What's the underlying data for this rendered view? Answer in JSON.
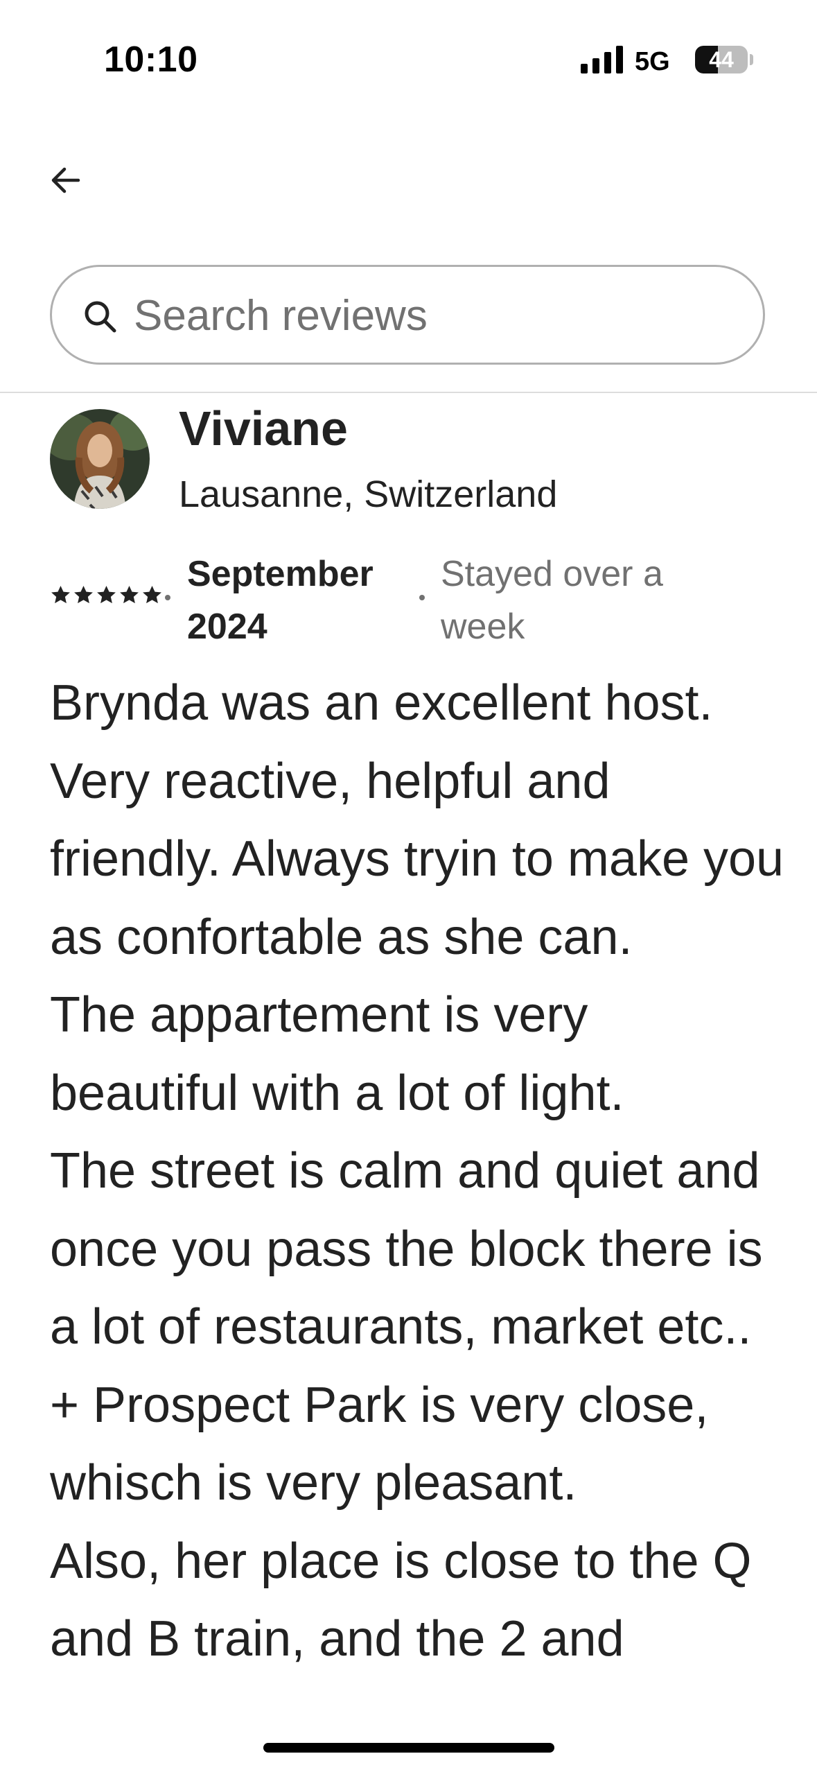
{
  "status_bar": {
    "time": "10:10",
    "network": "5G",
    "battery_level": "44",
    "battery_fraction": 0.44
  },
  "header": {
    "back_icon": "arrow-left-icon"
  },
  "search": {
    "placeholder": "Search reviews",
    "value": "",
    "icon": "search-icon"
  },
  "review": {
    "reviewer_name": "Viviane",
    "reviewer_location": "Lausanne, Switzerland",
    "rating": 5,
    "date": "September 2024",
    "stay_duration": "Stayed over a week",
    "text": "Brynda was an excellent host. Very reactive, helpful and friendly. Always tryin to make you as confortable as she can.\nThe appartement is very beautiful with a lot of light.\nThe street is calm and quiet and once you pass the block there is a lot of restaurants, market etc..  + Prospect Park is very close, whisch is very pleasant.\nAlso, her place is close to the Q and B train, and the 2 and"
  },
  "colors": {
    "text_primary": "#222222",
    "text_secondary": "#717171",
    "border": "#b0b0b0",
    "divider": "#dddddd"
  }
}
